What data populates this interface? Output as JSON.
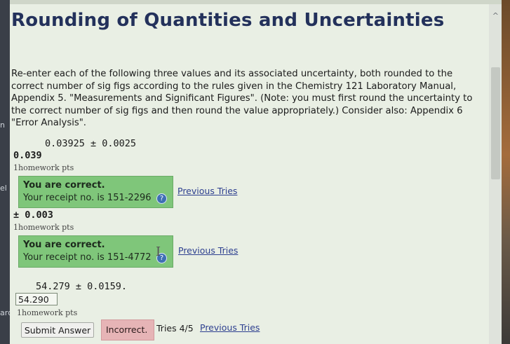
{
  "page": {
    "title": "Rounding of Quantities and Uncertainties"
  },
  "instructions": "Re-enter each of the following three values and its associated uncertainty, both rounded to the correct number of sig figs according to the rules given in the Chemistry 121 Laboratory Manual, Appendix 5. \"Measurements and Significant Figures\". (Note: you must first round the uncertainty to the correct number of sig figs and then round the value appropriately.) Consider also: Appendix 6 \"Error Analysis\".",
  "problem1": {
    "given": "0.03925 ± 0.0025",
    "answer": "0.039",
    "points": "1homework pts",
    "feedback": {
      "title": "You are correct.",
      "receipt": "Your receipt no. is 151-2296"
    },
    "previous_tries": "Previous Tries"
  },
  "problem2": {
    "answer": "± 0.003",
    "points": "1homework pts",
    "feedback": {
      "title": "You are correct.",
      "receipt": "Your receipt no. is 151-4772"
    },
    "previous_tries": "Previous Tries"
  },
  "problem3": {
    "given": "54.279 ± 0.0159.",
    "input_value": "54.290",
    "points": "1homework pts",
    "submit_label": "Submit Answer",
    "status": "Incorrect.",
    "tries": "Tries 4/5",
    "previous_tries": "Previous Tries"
  },
  "edge_labels": {
    "left_top": "n",
    "left_mid": "el",
    "left_low": "ard"
  },
  "icons": {
    "help": "?",
    "scroll_up": "^",
    "text_cursor": "I"
  },
  "colors": {
    "title": "#23315b",
    "correct_bg": "#7fc67a",
    "incorrect_bg": "#e6b4b6",
    "link": "#2d3f8f",
    "page_bg": "#e9efe4"
  }
}
